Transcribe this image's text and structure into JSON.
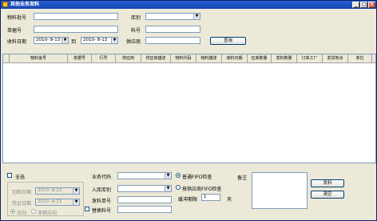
{
  "window": {
    "title": "其他业务发料",
    "minimize": "_",
    "maximize": "□",
    "close": "×"
  },
  "filters": {
    "material_no_label": "物料批号",
    "warehouse_label": "库别",
    "batch_no_label": "单据号",
    "item_no_label": "料号",
    "receive_date_label": "收料日期",
    "date_from": "2010- 8-13",
    "to_label": "到",
    "date_to": "2010- 8-13",
    "supplier_label": "供应商",
    "query_button": "查询"
  },
  "grid": {
    "columns": [
      "物料批号",
      "单据号",
      "行号",
      "供应商",
      "供应商描述",
      "物料代码",
      "物料描述",
      "收料日期",
      "在库数量",
      "发料数量",
      "订单工厂",
      "发货地点",
      "单位"
    ]
  },
  "bottom": {
    "select_all_label": "全选",
    "cutoff_date_label": "切割日期",
    "cutoff_date_value": "2010- 8-13",
    "voucher_date_label": "凭证日期",
    "voucher_date_value": "2010- 8-13",
    "radio_left_label": "正向",
    "radio_right_label": "冲销方向",
    "business_code_label": "业务代码",
    "warehouse_in_label": "入库库别",
    "issue_no_label": "发料单号",
    "replace_item_label": "替换料号",
    "fifo_radio_label": "普通FIFO检查",
    "supplier_fifo_label": "按供应商FIFO检查",
    "buffer_days_label": "缓冲期限",
    "buffer_days_value": "1",
    "days_unit": "天",
    "remark_label": "备注",
    "issue_button": "发料",
    "clear_button": "清空"
  }
}
